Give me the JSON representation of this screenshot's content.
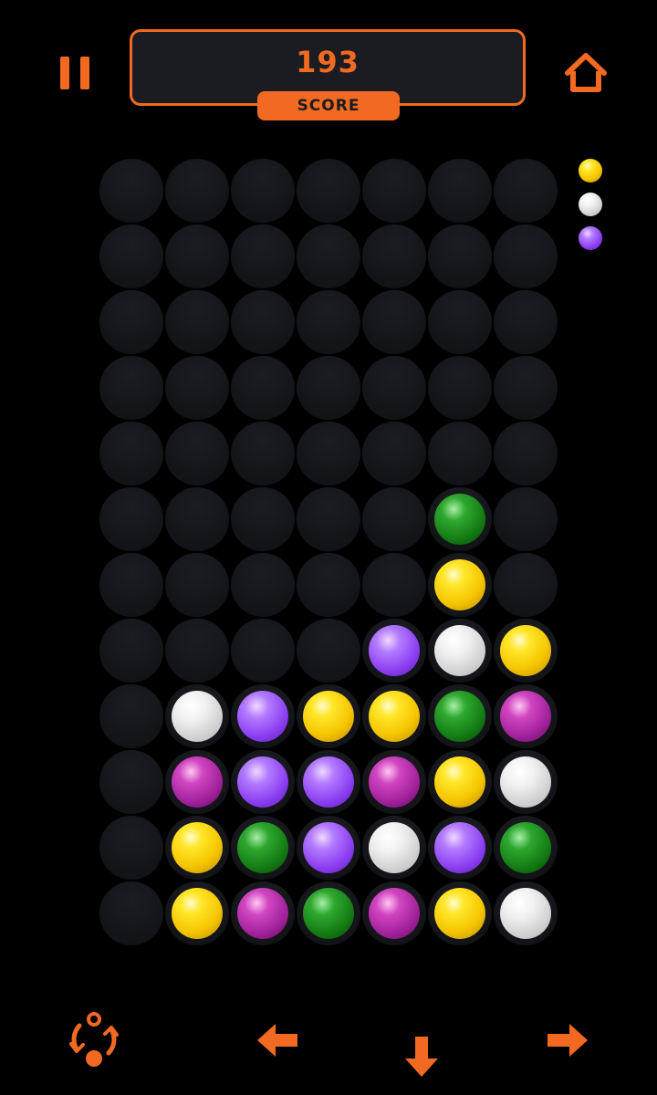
{
  "score": {
    "value": "193",
    "label": "SCORE"
  },
  "colors": {
    "accent": "#f26a21",
    "panel": "#1b1c21",
    "yellow": "#ffe72a",
    "white": "#f1f1f1",
    "purple": "#8a3cf0",
    "green": "#137a13",
    "magenta": "#a0209a"
  },
  "icons": {
    "pause": "pause-icon",
    "home": "home-icon",
    "rotate": "rotate-icon",
    "left": "arrow-left-icon",
    "down": "arrow-down-icon",
    "right": "arrow-right-icon"
  },
  "next_balls": [
    "yellow",
    "white",
    "purple"
  ],
  "board": {
    "columns": 7,
    "rows": 12,
    "grid": [
      [
        null,
        null,
        null,
        null,
        null,
        null,
        null
      ],
      [
        null,
        null,
        null,
        null,
        null,
        null,
        null
      ],
      [
        null,
        null,
        null,
        null,
        null,
        null,
        null
      ],
      [
        null,
        null,
        null,
        null,
        null,
        null,
        null
      ],
      [
        null,
        null,
        null,
        null,
        null,
        null,
        null
      ],
      [
        null,
        null,
        null,
        null,
        null,
        "green",
        null
      ],
      [
        null,
        null,
        null,
        null,
        null,
        "yellow",
        null
      ],
      [
        null,
        null,
        null,
        null,
        "purple",
        "white",
        "yellow"
      ],
      [
        null,
        "white",
        "purple",
        "yellow",
        "yellow",
        "green",
        "magenta"
      ],
      [
        null,
        "magenta",
        "purple",
        "purple",
        "magenta",
        "yellow",
        "white"
      ],
      [
        null,
        "yellow",
        "green",
        "purple",
        "white",
        "purple",
        "green"
      ],
      [
        null,
        "yellow",
        "magenta",
        "green",
        "magenta",
        "yellow",
        "white"
      ]
    ]
  }
}
